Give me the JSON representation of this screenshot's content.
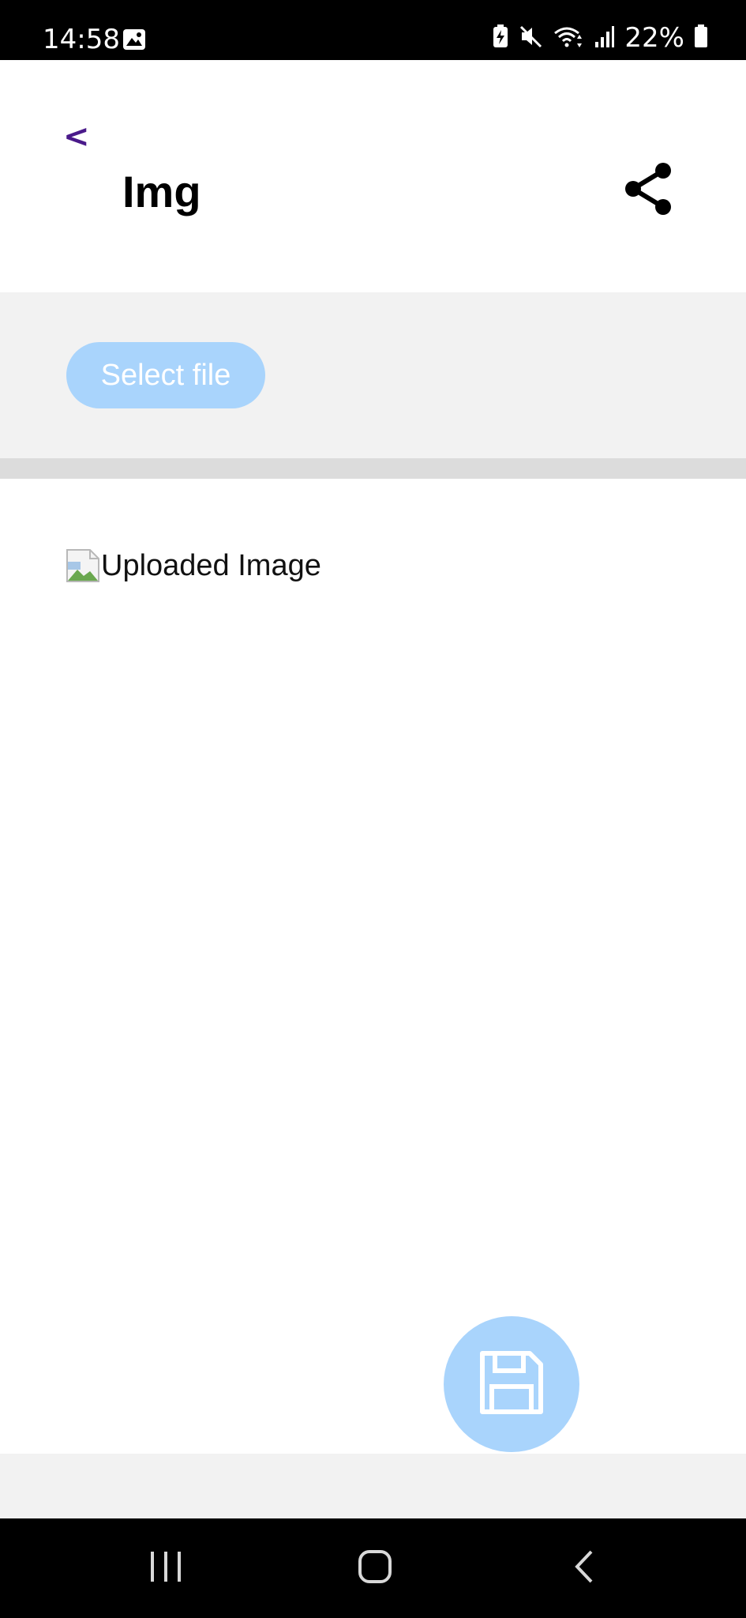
{
  "status_bar": {
    "time": "14:58",
    "battery_percent": "22%",
    "icons": [
      "gallery-icon",
      "battery-saver-icon",
      "mute-icon",
      "wifi-icon",
      "signal-icon",
      "battery-icon"
    ]
  },
  "header": {
    "back_label": "<",
    "title": "Img",
    "share_icon": "share-icon"
  },
  "upload": {
    "select_file_label": "Select file"
  },
  "content": {
    "image_alt": "Uploaded Image"
  },
  "fab": {
    "icon": "save-icon"
  },
  "colors": {
    "accent_light_blue": "#a9d4fc",
    "back_purple": "#4a1a8a",
    "section_gray": "#f2f2f2",
    "divider_gray": "#dcdcdc"
  },
  "nav_bar": {
    "items": [
      "recents-icon",
      "home-icon",
      "back-icon"
    ]
  }
}
